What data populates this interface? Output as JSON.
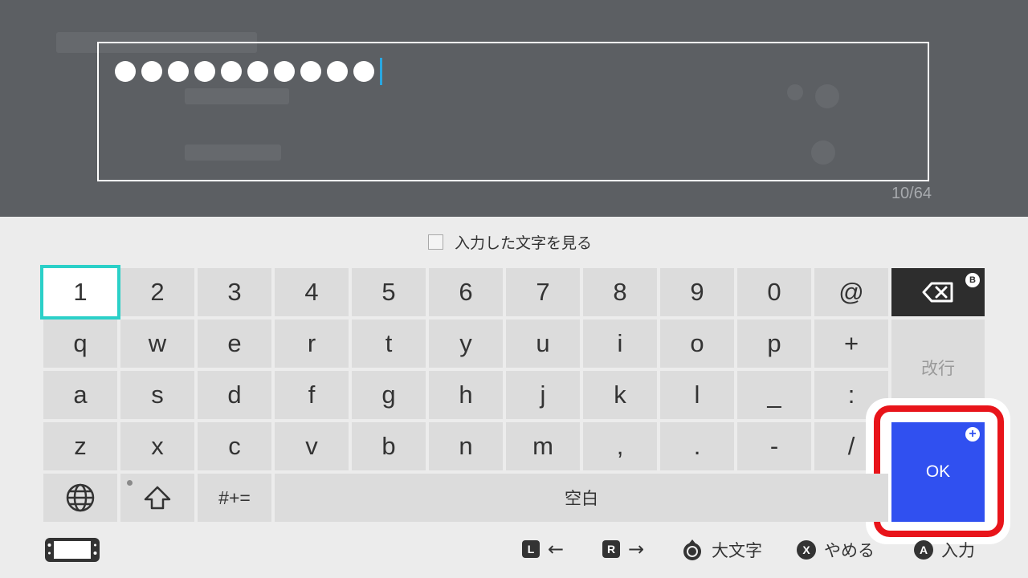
{
  "input": {
    "mask_count": 10,
    "counter": "10/64"
  },
  "toggle": {
    "label": "入力した文字を見る",
    "checked": false
  },
  "keyboard": {
    "rows": [
      [
        "1",
        "2",
        "3",
        "4",
        "5",
        "6",
        "7",
        "8",
        "9",
        "0",
        "@"
      ],
      [
        "q",
        "w",
        "e",
        "r",
        "t",
        "y",
        "u",
        "i",
        "o",
        "p",
        "+"
      ],
      [
        "a",
        "s",
        "d",
        "f",
        "g",
        "h",
        "j",
        "k",
        "l",
        "_",
        ":"
      ],
      [
        "z",
        "x",
        "c",
        "v",
        "b",
        "n",
        "m",
        ",",
        ".",
        "-",
        "/"
      ]
    ],
    "selected_key": "1",
    "enter_label": "改行",
    "ok_label": "OK",
    "symbols_label": "#+=",
    "space_label": "空白",
    "backspace_badge": "B",
    "icons": {
      "backspace": "backspace-icon",
      "globe": "globe-icon",
      "shift": "shift-icon",
      "ok_badge": "plus-icon"
    }
  },
  "footer": {
    "l_button": "L",
    "r_button": "R",
    "caps_label": "大文字",
    "x_button": "X",
    "cancel_label": "やめる",
    "a_button": "A",
    "enter_label": "入力",
    "icons": {
      "console": "handheld-console-icon",
      "left": "arrow-left-icon",
      "right": "arrow-right-icon",
      "stick": "left-stick-icon"
    }
  },
  "colors": {
    "selected_outline": "#2bd0c8",
    "ok_button": "#3050f0",
    "highlight_frame": "#e8141a",
    "top_overlay": "#5c5f63"
  }
}
